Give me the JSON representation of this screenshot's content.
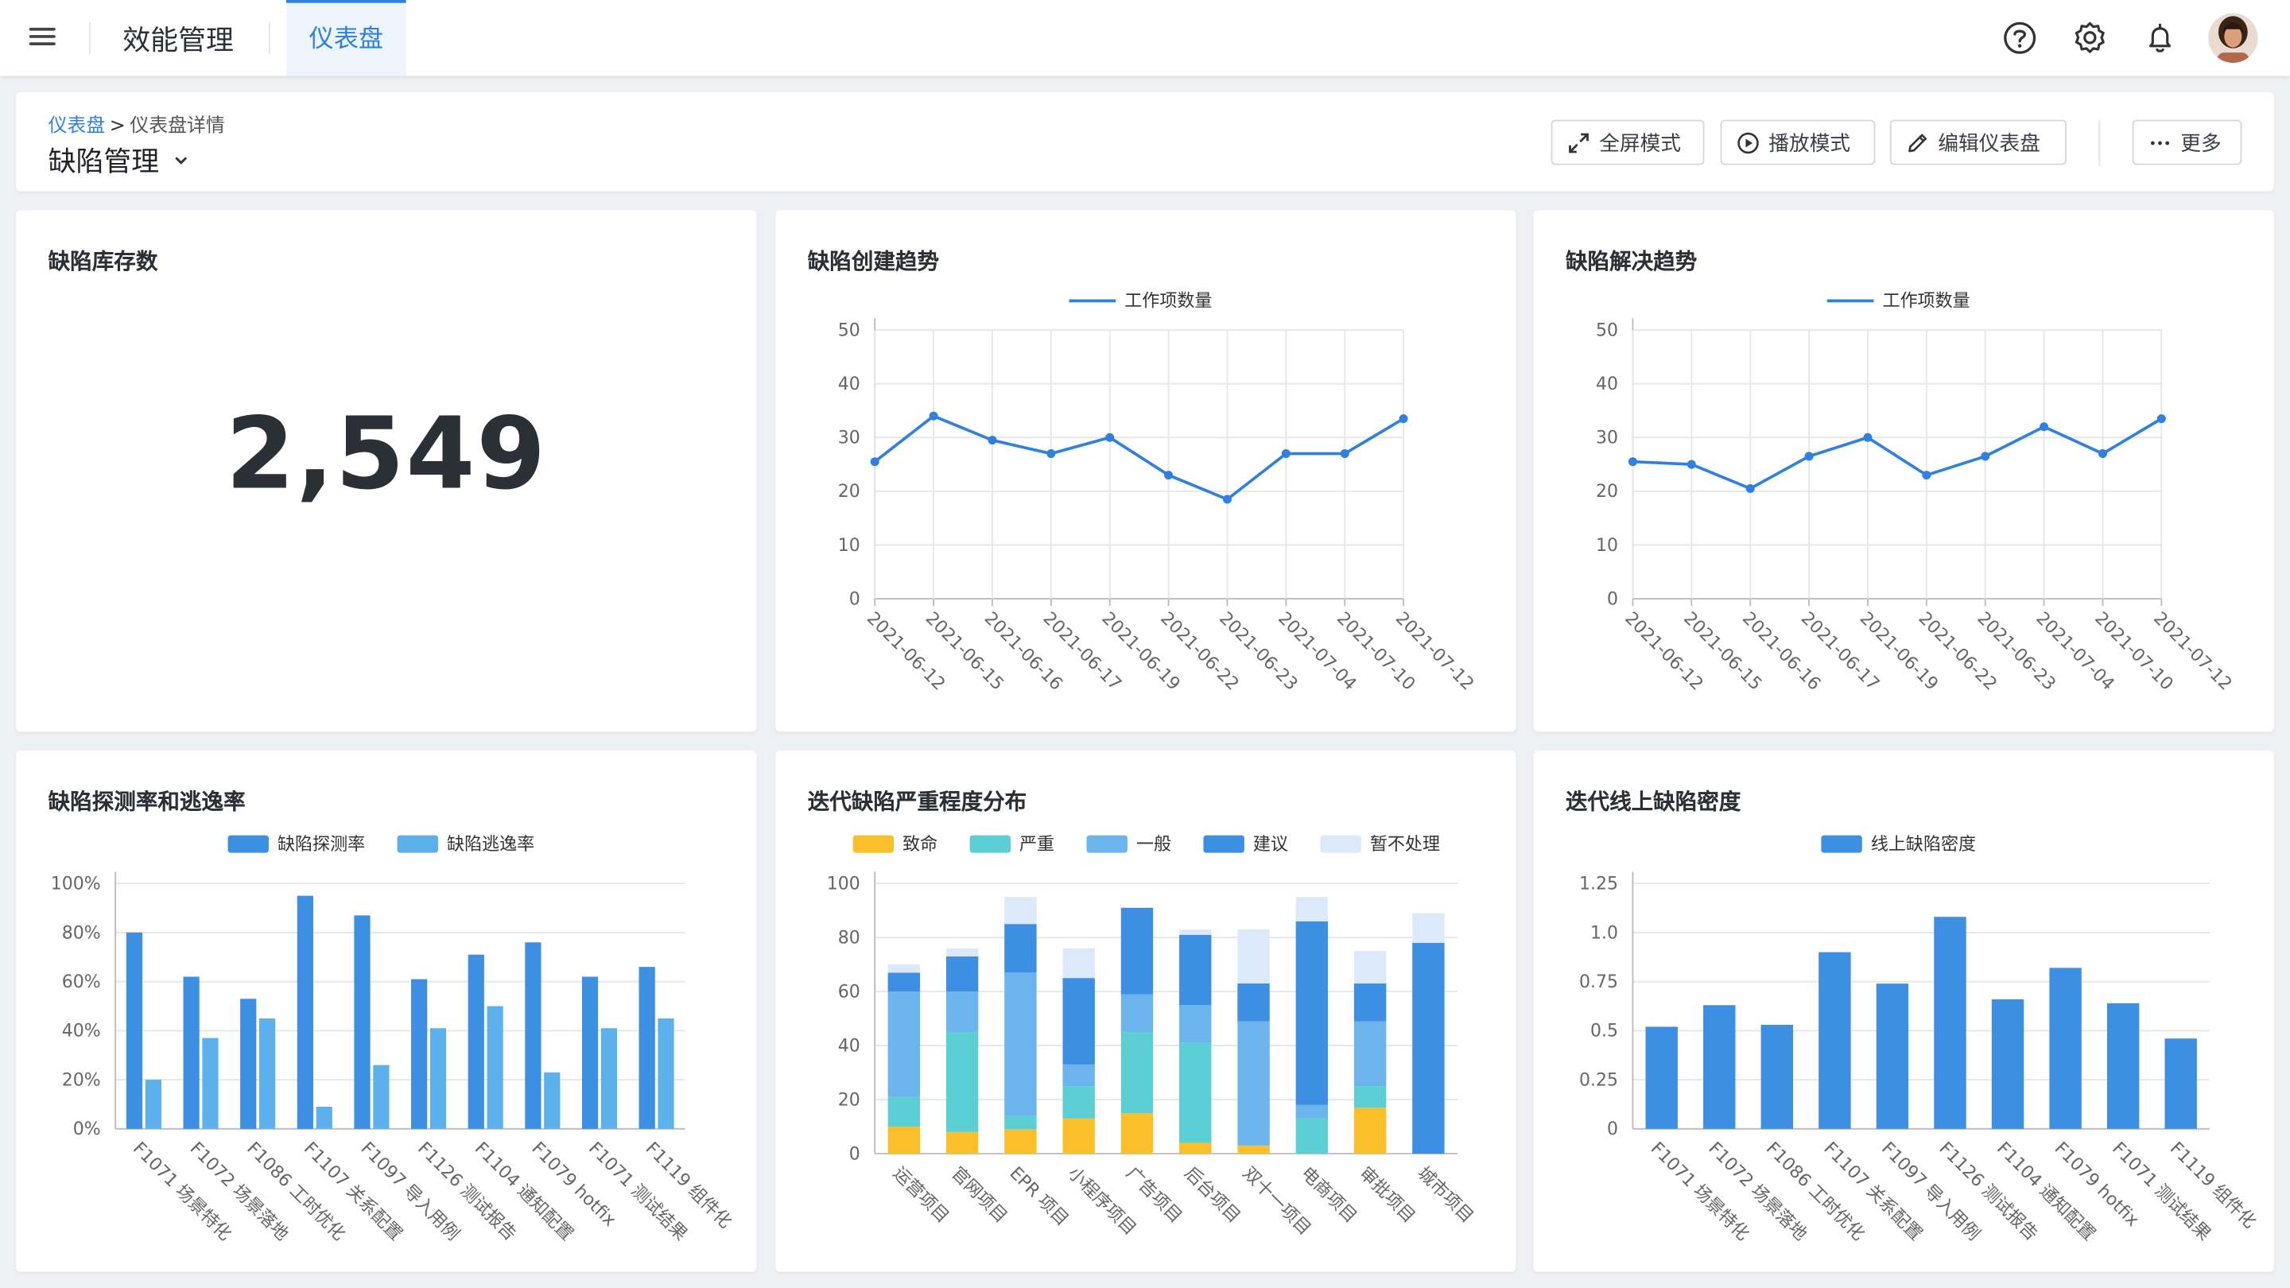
{
  "topbar": {
    "app_title": "效能管理",
    "active_tab": "仪表盘",
    "icons": [
      "menu-icon",
      "help-icon",
      "settings-icon",
      "bell-icon",
      "avatar"
    ]
  },
  "header": {
    "breadcrumb_root": "仪表盘",
    "breadcrumb_sep": ">",
    "breadcrumb_current": "仪表盘详情",
    "title": "缺陷管理",
    "buttons": {
      "fullscreen": "全屏模式",
      "play": "播放模式",
      "edit": "编辑仪表盘",
      "more": "更多"
    }
  },
  "colors": {
    "accent": "#2f80e0",
    "line": "#2f80e0",
    "bar_detect": "#3d8fe3",
    "bar_escape": "#5cb0ec",
    "fatal": "#fbbf2a",
    "severe": "#5ccfd4",
    "normal": "#6cb4ee",
    "suggest": "#3d8fe3",
    "ignore": "#dbe9fb"
  },
  "cards": {
    "stock": {
      "title": "缺陷库存数",
      "value": "2,549"
    },
    "create_trend": {
      "title": "缺陷创建趋势"
    },
    "resolve_trend": {
      "title": "缺陷解决趋势"
    },
    "detect_escape": {
      "title": "缺陷探测率和逃逸率"
    },
    "severity": {
      "title": "迭代缺陷严重程度分布"
    },
    "density": {
      "title": "迭代线上缺陷密度"
    }
  },
  "chart_data": [
    {
      "id": "create_trend",
      "type": "line",
      "x": [
        "2021-06-12",
        "2021-06-15",
        "2021-06-16",
        "2021-06-17",
        "2021-06-19",
        "2021-06-22",
        "2021-06-23",
        "2021-07-04",
        "2021-07-10",
        "2021-07-12"
      ],
      "series": [
        {
          "name": "工作项数量",
          "values": [
            25.5,
            34,
            29.5,
            27,
            30,
            23,
            18.5,
            27,
            27,
            33.5
          ]
        }
      ],
      "yticks": [
        "0",
        "10",
        "20",
        "30",
        "40",
        "50"
      ],
      "ylim": [
        0,
        50
      ],
      "grid": true,
      "legend": "top"
    },
    {
      "id": "resolve_trend",
      "type": "line",
      "x": [
        "2021-06-12",
        "2021-06-15",
        "2021-06-16",
        "2021-06-17",
        "2021-06-19",
        "2021-06-22",
        "2021-06-23",
        "2021-07-04",
        "2021-07-10",
        "2021-07-12"
      ],
      "series": [
        {
          "name": "工作项数量",
          "values": [
            25.5,
            25,
            20.5,
            26.5,
            30,
            23,
            26.5,
            32,
            27,
            33.5
          ]
        }
      ],
      "yticks": [
        "0",
        "10",
        "20",
        "30",
        "40",
        "50"
      ],
      "ylim": [
        0,
        50
      ],
      "grid": true,
      "legend": "top"
    },
    {
      "id": "detect_escape",
      "type": "bar",
      "categories": [
        "F1071 场景特化",
        "F1072 场景落地",
        "F1086 工时优化",
        "F1107 关系配置",
        "F1097 导入用例",
        "F1126 测试报告",
        "F1104 通知配置",
        "F1079 hotfix",
        "F1071 测试结果",
        "F1119 组件化"
      ],
      "series": [
        {
          "name": "缺陷探测率",
          "values": [
            80,
            62,
            53,
            95,
            87,
            61,
            71,
            76,
            62,
            66
          ]
        },
        {
          "name": "缺陷逃逸率",
          "values": [
            20,
            37,
            45,
            9,
            26,
            41,
            50,
            23,
            41,
            45
          ]
        }
      ],
      "yticks": [
        "0%",
        "20%",
        "40%",
        "60%",
        "80%",
        "100%"
      ],
      "ylim": [
        0,
        100
      ],
      "grid": true,
      "legend": "top"
    },
    {
      "id": "severity",
      "type": "bar",
      "stacked": true,
      "categories": [
        "运营项目",
        "官网项目",
        "EPR 项目",
        "小程序项目",
        "广告项目",
        "后台项目",
        "双十一项目",
        "电商项目",
        "审批项目",
        "城市项目"
      ],
      "series": [
        {
          "name": "致命",
          "values": [
            10,
            8,
            9,
            13,
            15,
            4,
            3,
            0,
            17,
            0
          ]
        },
        {
          "name": "严重",
          "values": [
            11,
            37,
            5,
            12,
            30,
            37,
            0,
            13,
            8,
            0
          ]
        },
        {
          "name": "一般",
          "values": [
            39,
            15,
            53,
            8,
            14,
            14,
            46,
            5,
            24,
            0
          ]
        },
        {
          "name": "建议",
          "values": [
            7,
            13,
            18,
            32,
            32,
            26,
            14,
            68,
            14,
            78
          ]
        },
        {
          "name": "暂不处理",
          "values": [
            3,
            3,
            10,
            11,
            0,
            2,
            20,
            9,
            12,
            11
          ]
        }
      ],
      "yticks": [
        "0",
        "20",
        "40",
        "60",
        "80",
        "100"
      ],
      "ylim": [
        0,
        100
      ],
      "grid": true,
      "legend": "top"
    },
    {
      "id": "density",
      "type": "bar",
      "categories": [
        "F1071 场景特化",
        "F1072 场景落地",
        "F1086 工时优化",
        "F1107 关系配置",
        "F1097 导入用例",
        "F1126 测试报告",
        "F1104 通知配置",
        "F1079 hotfix",
        "F1071 测试结果",
        "F1119 组件化"
      ],
      "series": [
        {
          "name": "线上缺陷密度",
          "values": [
            0.52,
            0.63,
            0.53,
            0.9,
            0.74,
            1.08,
            0.66,
            0.82,
            0.64,
            0.46
          ]
        }
      ],
      "yticks": [
        "0",
        "0.25",
        "0.5",
        "0.75",
        "1.0",
        "1.25"
      ],
      "ylim": [
        0,
        1.25
      ],
      "grid": true,
      "legend": "top"
    }
  ]
}
